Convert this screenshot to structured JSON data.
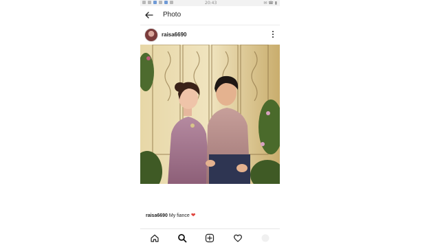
{
  "status_bar": {
    "time": "20:43",
    "right_text": "✉ ☎ ▮"
  },
  "header": {
    "title": "Photo",
    "back_icon": "arrow-left-icon"
  },
  "post": {
    "username": "raisa6690",
    "more_icon": "more-vertical-icon",
    "caption_user": "raisa6690",
    "caption_text": "My fiance",
    "caption_emoji": "❤"
  },
  "bottom_nav": {
    "items": [
      "home-icon",
      "search-icon",
      "add-post-icon",
      "activity-heart-icon",
      "profile-icon"
    ]
  },
  "colors": {
    "dress": "#a77892",
    "shirt": "#b78e8c",
    "background_gold": "#d9c389"
  }
}
